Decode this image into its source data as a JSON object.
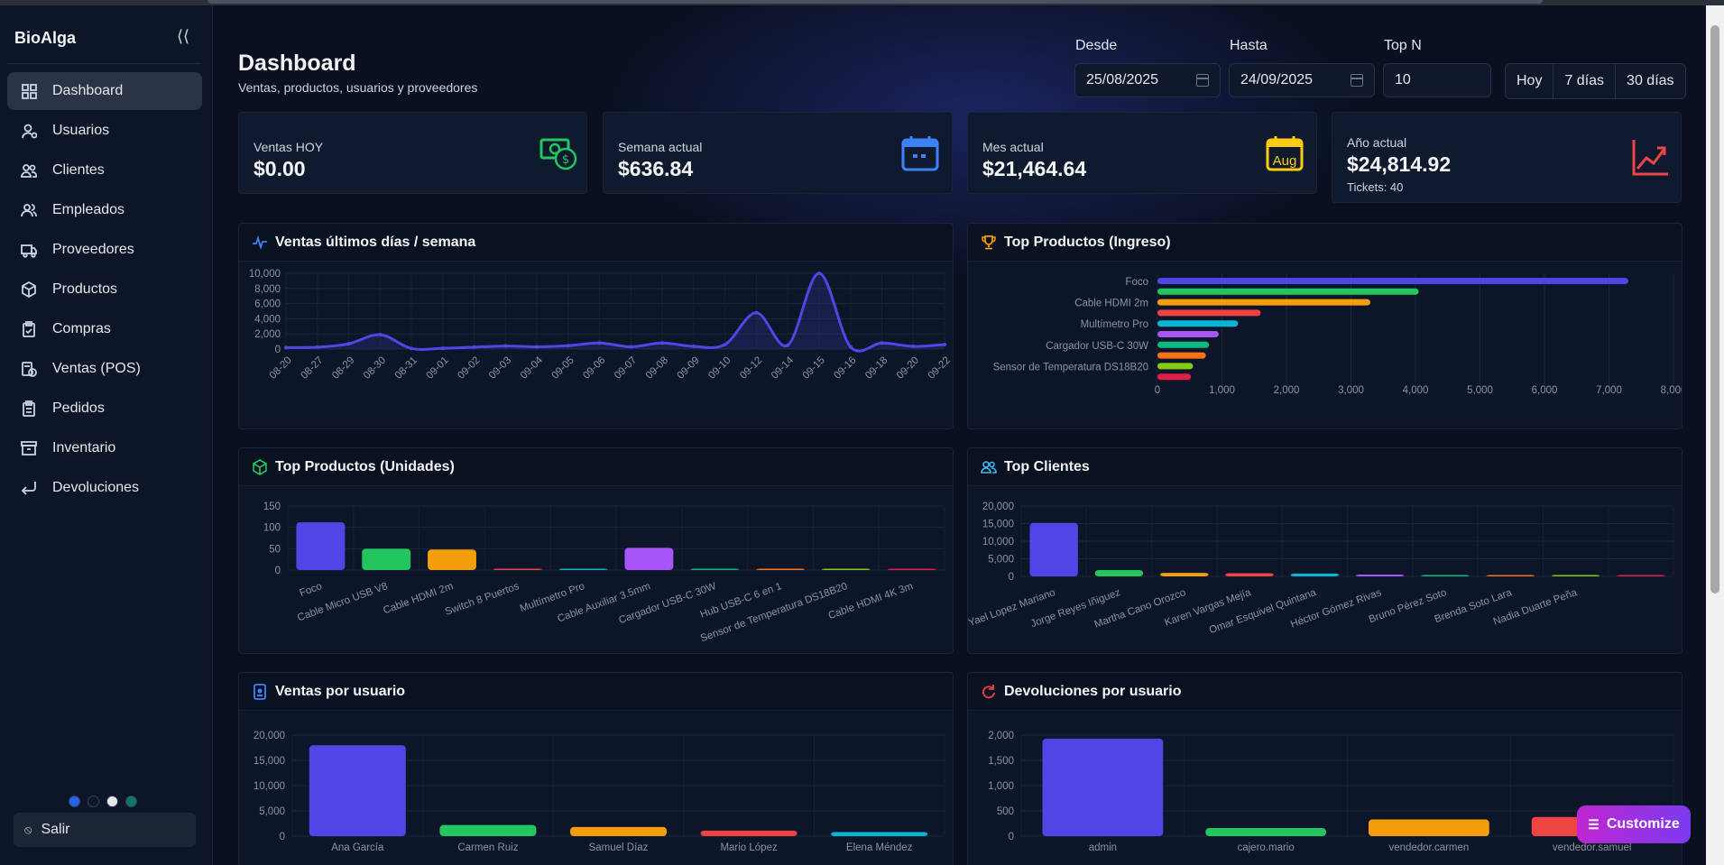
{
  "sidebar": {
    "brand": "BioAlga",
    "items": [
      {
        "label": "Dashboard",
        "icon": "grid-icon",
        "active": true
      },
      {
        "label": "Usuarios",
        "icon": "user-gear-icon"
      },
      {
        "label": "Clientes",
        "icon": "users-icon"
      },
      {
        "label": "Empleados",
        "icon": "team-icon"
      },
      {
        "label": "Proveedores",
        "icon": "truck-icon"
      },
      {
        "label": "Productos",
        "icon": "box-icon"
      },
      {
        "label": "Compras",
        "icon": "clipboard-check-icon"
      },
      {
        "label": "Ventas (POS)",
        "icon": "pos-icon"
      },
      {
        "label": "Pedidos",
        "icon": "clipboard-list-icon"
      },
      {
        "label": "Inventario",
        "icon": "archive-icon"
      },
      {
        "label": "Devoluciones",
        "icon": "return-icon"
      }
    ],
    "theme_dots": [
      "#2563eb",
      "#0f172a",
      "#e5e7eb",
      "#0f766e"
    ],
    "logout": "Salir"
  },
  "header": {
    "title": "Dashboard",
    "subtitle": "Ventas, productos, usuarios y proveedores",
    "from_label": "Desde",
    "from_value": "25/08/2025",
    "to_label": "Hasta",
    "to_value": "24/09/2025",
    "topn_label": "Top N",
    "topn_value": "10",
    "ranges": [
      "Hoy",
      "7 días",
      "30 días"
    ]
  },
  "kpis": [
    {
      "label": "Ventas HOY",
      "value": "$0.00",
      "icon": "money-icon",
      "color": "#22c55e"
    },
    {
      "label": "Semana actual",
      "value": "$636.84",
      "icon": "calendar-week-icon",
      "color": "#3b82f6"
    },
    {
      "label": "Mes actual",
      "value": "$21,464.64",
      "icon": "calendar-month-icon",
      "color": "#facc15",
      "icon_text": "Aug"
    },
    {
      "label": "Año actual",
      "value": "$24,814.92",
      "sub": "Tickets: 40",
      "icon": "trend-up-icon",
      "color": "#ef4444"
    }
  ],
  "cards": {
    "sales_days": "Ventas últimos días / semana",
    "top_products_income": "Top Productos (Ingreso)",
    "top_products_units": "Top Productos (Unidades)",
    "top_clients": "Top Clientes",
    "sales_by_user": "Ventas por usuario",
    "returns_by_user": "Devoluciones por usuario"
  },
  "customize": "Customize",
  "palette": [
    "#4f46e5",
    "#22c55e",
    "#f59e0b",
    "#ef4444",
    "#06b6d4",
    "#a855f7",
    "#10b981",
    "#f97316",
    "#84cc16",
    "#e11d48"
  ],
  "chart_data": [
    {
      "type": "area",
      "title": "Ventas últimos días / semana",
      "x": [
        "08-20",
        "08-27",
        "08-29",
        "08-30",
        "08-31",
        "09-01",
        "09-02",
        "09-03",
        "09-04",
        "09-05",
        "09-06",
        "09-07",
        "09-08",
        "09-09",
        "09-10",
        "09-12",
        "09-14",
        "09-15",
        "09-16",
        "09-18",
        "09-20",
        "09-22"
      ],
      "values": [
        200,
        250,
        700,
        1900,
        80,
        100,
        250,
        400,
        300,
        450,
        800,
        300,
        800,
        350,
        600,
        4800,
        500,
        10000,
        300,
        800,
        350,
        600
      ],
      "ylim": [
        0,
        10000
      ],
      "yticks": [
        0,
        2000,
        4000,
        6000,
        8000,
        10000
      ],
      "color": "#4f46e5"
    },
    {
      "type": "bar",
      "orientation": "horizontal",
      "title": "Top Productos (Ingreso)",
      "categories": [
        "Foco",
        "",
        "Cable HDMI 2m",
        "",
        "Multímetro Pro",
        "",
        "Cargador USB-C 30W",
        "",
        "Sensor de Temperatura DS18B20",
        ""
      ],
      "values": [
        7300,
        4050,
        3300,
        1600,
        1250,
        950,
        800,
        750,
        550,
        520
      ],
      "xlim": [
        0,
        8000
      ],
      "xticks": [
        0,
        1000,
        2000,
        3000,
        4000,
        5000,
        6000,
        7000,
        8000
      ]
    },
    {
      "type": "bar",
      "title": "Top Productos (Unidades)",
      "categories": [
        "Foco",
        "Cable Micro USB V8",
        "Cable HDMI 2m",
        "Switch 8 Puertos",
        "Multímetro Pro",
        "Cable Auxiliar 3.5mm",
        "Cargador USB-C 30W",
        "Hub USB-C 6 en 1",
        "Sensor de Temperatura DS18B20",
        "Cable HDMI 4K 3m"
      ],
      "values": [
        112,
        50,
        48,
        1,
        1,
        52,
        1,
        0,
        2,
        1
      ],
      "ylim": [
        0,
        150
      ],
      "yticks": [
        0,
        50,
        100,
        150
      ]
    },
    {
      "type": "bar",
      "title": "Top Clientes",
      "categories": [
        "Yael Lopez Mariano",
        "Jorge Reyes Iñiguez",
        "Martha Cano Orozco",
        "Karen Vargas Mejía",
        "Omar Esquivel Quintana",
        "Héctor Gómez Rivas",
        "Bruno Pérez Soto",
        "Brenda Soto Lara",
        "Nadia Duarte Peña",
        ""
      ],
      "values": [
        15200,
        1800,
        1000,
        900,
        800,
        500,
        350,
        250,
        200,
        150
      ],
      "ylim": [
        0,
        20000
      ],
      "yticks": [
        0,
        5000,
        10000,
        15000,
        20000
      ]
    },
    {
      "type": "bar",
      "title": "Ventas por usuario",
      "categories": [
        "Ana García",
        "Carmen Ruiz",
        "Samuel Díaz",
        "Mario López",
        "Elena Méndez"
      ],
      "values": [
        18000,
        2200,
        1800,
        1100,
        800
      ],
      "ylim": [
        0,
        20000
      ],
      "yticks": [
        0,
        5000,
        10000,
        15000,
        20000
      ]
    },
    {
      "type": "bar",
      "title": "Devoluciones por usuario",
      "categories": [
        "admin",
        "cajero.mario",
        "vendedor.carmen",
        "vendedor.samuel"
      ],
      "values": [
        1930,
        160,
        330,
        380
      ],
      "ylim": [
        0,
        2000
      ],
      "yticks": [
        0,
        500,
        1000,
        1500,
        2000
      ]
    }
  ]
}
